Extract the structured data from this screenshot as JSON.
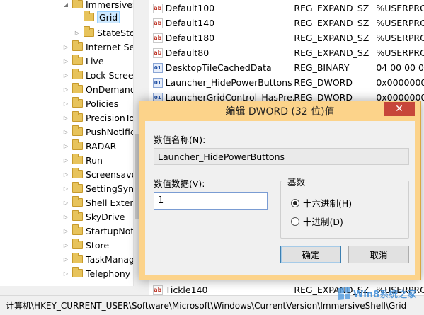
{
  "tree": {
    "items": [
      {
        "label": "ImmersiveS",
        "expanded": true
      },
      {
        "label": "Grid",
        "selected": true
      },
      {
        "label": "StateSto"
      },
      {
        "label": "Internet Se"
      },
      {
        "label": "Live"
      },
      {
        "label": "Lock Scree"
      },
      {
        "label": "OnDemand"
      },
      {
        "label": "Policies"
      },
      {
        "label": "PrecisionTo"
      },
      {
        "label": "PushNotific"
      },
      {
        "label": "RADAR"
      },
      {
        "label": "Run"
      },
      {
        "label": "Screensave"
      },
      {
        "label": "SettingSync"
      },
      {
        "label": "Shell Extens"
      },
      {
        "label": "SkyDrive"
      },
      {
        "label": "StartupNot"
      },
      {
        "label": "Store"
      },
      {
        "label": "TaskManag"
      },
      {
        "label": "Telephony"
      }
    ]
  },
  "values": {
    "rows": [
      {
        "name": "Default100",
        "type": "REG_EXPAND_SZ",
        "data": "%USERPRO",
        "icon": "ab"
      },
      {
        "name": "Default140",
        "type": "REG_EXPAND_SZ",
        "data": "%USERPRO",
        "icon": "ab"
      },
      {
        "name": "Default180",
        "type": "REG_EXPAND_SZ",
        "data": "%USERPRO",
        "icon": "ab"
      },
      {
        "name": "Default80",
        "type": "REG_EXPAND_SZ",
        "data": "%USERPRO",
        "icon": "ab"
      },
      {
        "name": "DesktopTileCachedData",
        "type": "REG_BINARY",
        "data": "04 00 00 0",
        "icon": "bin"
      },
      {
        "name": "Launcher_HidePowerButtons",
        "type": "REG_DWORD",
        "data": "0x0000000",
        "icon": "bin"
      },
      {
        "name": "LauncherGridControl_HasPre...",
        "type": "REG_DWORD",
        "data": "0x0000000",
        "icon": "bin"
      }
    ],
    "last_row": {
      "name": "Tickle140",
      "type": "REG_EXPAND_SZ",
      "data": "%USERPRO",
      "icon": "ab"
    }
  },
  "status_bar": {
    "path": "计算机\\HKEY_CURRENT_USER\\Software\\Microsoft\\Windows\\CurrentVersion\\ImmersiveShell\\Grid"
  },
  "dialog": {
    "title": "编辑 DWORD (32 位)值",
    "close_symbol": "✕",
    "name_label": "数值名称(N):",
    "name_value": "Launcher_HidePowerButtons",
    "data_label": "数值数据(V):",
    "data_value": "1",
    "base_label": "基数",
    "radio_hex": "十六进制(H)",
    "radio_dec": "十进制(D)",
    "selected_base": "hex",
    "ok_label": "确定",
    "cancel_label": "取消"
  },
  "watermark": {
    "text": "Win8系统之家"
  },
  "colors": {
    "dialog_frame": "#fcd38a",
    "close_button": "#c7463a",
    "selection": "#cce8ff"
  }
}
